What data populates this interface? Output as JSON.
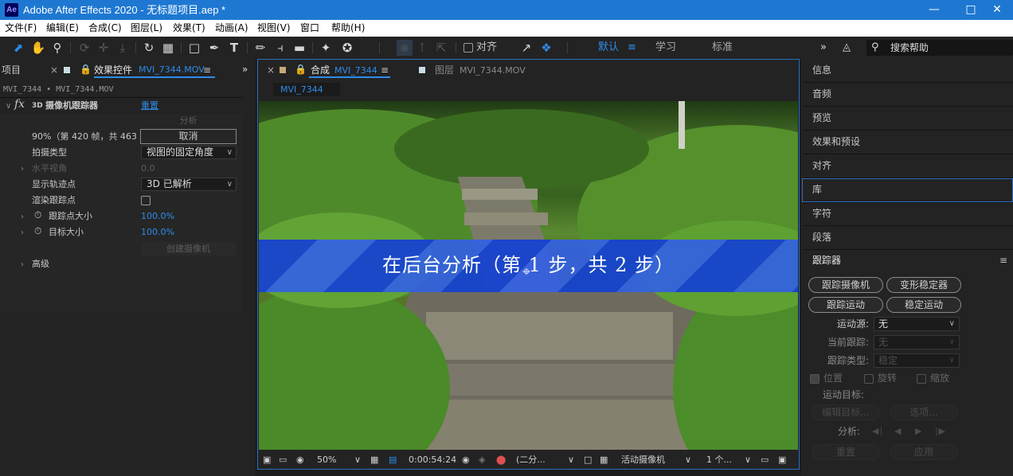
{
  "window": {
    "title": "Adobe After Effects 2020 - 无标题项目.aep *",
    "logo": "Ae",
    "minimize_icon": "minimize-icon",
    "maximize_icon": "maximize-icon",
    "close_icon": "close-icon"
  },
  "menu": [
    "文件(F)",
    "编辑(E)",
    "合成(C)",
    "图层(L)",
    "效果(T)",
    "动画(A)",
    "视图(V)",
    "窗口",
    "帮助(H)"
  ],
  "toolbar": {
    "snap_label": "对齐",
    "workspaces": [
      "默认",
      "学习",
      "标准"
    ],
    "active_workspace": "默认",
    "search_placeholder": "搜索帮助"
  },
  "left_panel": {
    "project_tab": "项目",
    "effects_tab": "效果控件",
    "effects_tab_file": "MVI_7344.MOV",
    "breadcrumb": "MVI_7344 • MVI_7344.MOV",
    "effect_badge": "3D",
    "effect_name": "摄像机跟踪器",
    "reset_link": "重置",
    "analyze_button": "分析",
    "progress_text": "90%（第 420 帧，共 463",
    "cancel_button": "取消",
    "shot_type_label": "拍摄类型",
    "shot_type_value": "视图的固定角度",
    "fov_label": "水平视角",
    "fov_value": "0.0",
    "show_track_label": "显示轨迹点",
    "show_track_value": "3D 已解析",
    "render_track_label": "渲染跟踪点",
    "track_size_label": "跟踪点大小",
    "track_size_value": "100.0%",
    "target_size_label": "目标大小",
    "target_size_value": "100.0%",
    "create_camera_button": "创建摄像机",
    "advanced_label": "高级"
  },
  "comp_panel": {
    "comp_tab": "合成",
    "comp_tab_name": "MVI_7344",
    "layer_tab": "图层",
    "layer_tab_name": "MVI_7344.MOV",
    "sub_tab": "MVI_7344",
    "overlay_text": "在后台分析（第 1 步，共 2 步）",
    "analysis_step": 1,
    "analysis_total_steps": 2,
    "zoom": "50%",
    "timecode": "0:00:54:24",
    "resolution": "(二分...",
    "camera": "活动摄像机",
    "views": "1 个..."
  },
  "right_panel": {
    "items": [
      "信息",
      "音频",
      "预览",
      "效果和预设",
      "对齐",
      "库",
      "字符",
      "段落"
    ],
    "selected_item": "库",
    "tracker": {
      "title": "跟踪器",
      "buttons": [
        "跟踪摄像机",
        "变形稳定器",
        "跟踪运动",
        "稳定运动"
      ],
      "motion_source_label": "运动源:",
      "motion_source_value": "无",
      "current_track_label": "当前跟踪:",
      "current_track_value": "无",
      "track_type_label": "跟踪类型:",
      "track_type_value": "稳定",
      "position_label": "位置",
      "rotation_label": "旋转",
      "scale_label": "缩放",
      "motion_target_label": "运动目标:",
      "edit_target_button": "编辑目标...",
      "options_button": "选项...",
      "analyze_label": "分析:",
      "reset_button": "重置",
      "apply_button": "应用"
    }
  },
  "colors": {
    "title_bar": "#1e78d2",
    "accent_blue": "#2d8ceb",
    "panel_bg": "#232323",
    "banner_blue": "#1f46d6"
  }
}
